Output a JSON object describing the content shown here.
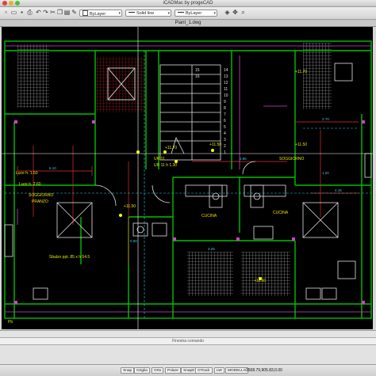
{
  "window": {
    "title": "iCADMac by progeCAD"
  },
  "toolbar": {
    "color_value": "ByLayer",
    "linetype_value": "Solid line",
    "lineweight_value": "ByLayer",
    "icons": [
      "new-icon",
      "open-icon",
      "save-icon",
      "print-icon",
      "undo-icon",
      "redo-icon",
      "cut-icon",
      "copy-icon",
      "paste-icon",
      "match-properties-icon",
      "layer-icon",
      "pan-icon",
      "zoom-icon"
    ]
  },
  "document": {
    "tab_title": "Piant_1.dwg"
  },
  "drawing": {
    "room_labels": {
      "soggiorno_right": "SOGGIORNO",
      "soggiorno_left": "SOGGIORNO",
      "pranzo": "PRANZO",
      "cucina_1": "CUCINA",
      "cucina_2": "CUCINA"
    },
    "elevations": [
      "+11.70",
      "+11.50",
      "+11.50",
      "+11.70",
      "+11.50",
      "+11.50"
    ],
    "dimension_texts": [
      "5.10",
      "2.70",
      "2.85",
      "1.20",
      "4.15",
      "0.90",
      "3.25"
    ],
    "notes": [
      "Luce h. 1.50",
      "Luce h. 2.60",
      "Sbalzo ppt. 85 x h 54.5",
      "UR 11",
      "UR 11 h 1.30",
      "Pb"
    ],
    "stair_numbers": [
      "1",
      "2",
      "3",
      "4",
      "5",
      "6",
      "7",
      "8",
      "9",
      "10",
      "11",
      "12",
      "13",
      "14",
      "15",
      "16"
    ]
  },
  "command": {
    "placeholder": "Finestra comando"
  },
  "statusbar": {
    "buttons": [
      "Snap",
      "Griglia",
      "Orto",
      "Polare",
      "SnapE",
      "OTrack",
      "LW",
      "MODELLO"
    ],
    "coordinates": "3568.79,905.83,0.00"
  },
  "colors": {
    "canvas_bg": "#000000",
    "walls": "#00c000",
    "hatch": "#c8c8c8",
    "red_lines": "#e03030",
    "magenta": "#d040d0",
    "cyan": "#30d0e0",
    "yellow_text": "#e6e600"
  }
}
